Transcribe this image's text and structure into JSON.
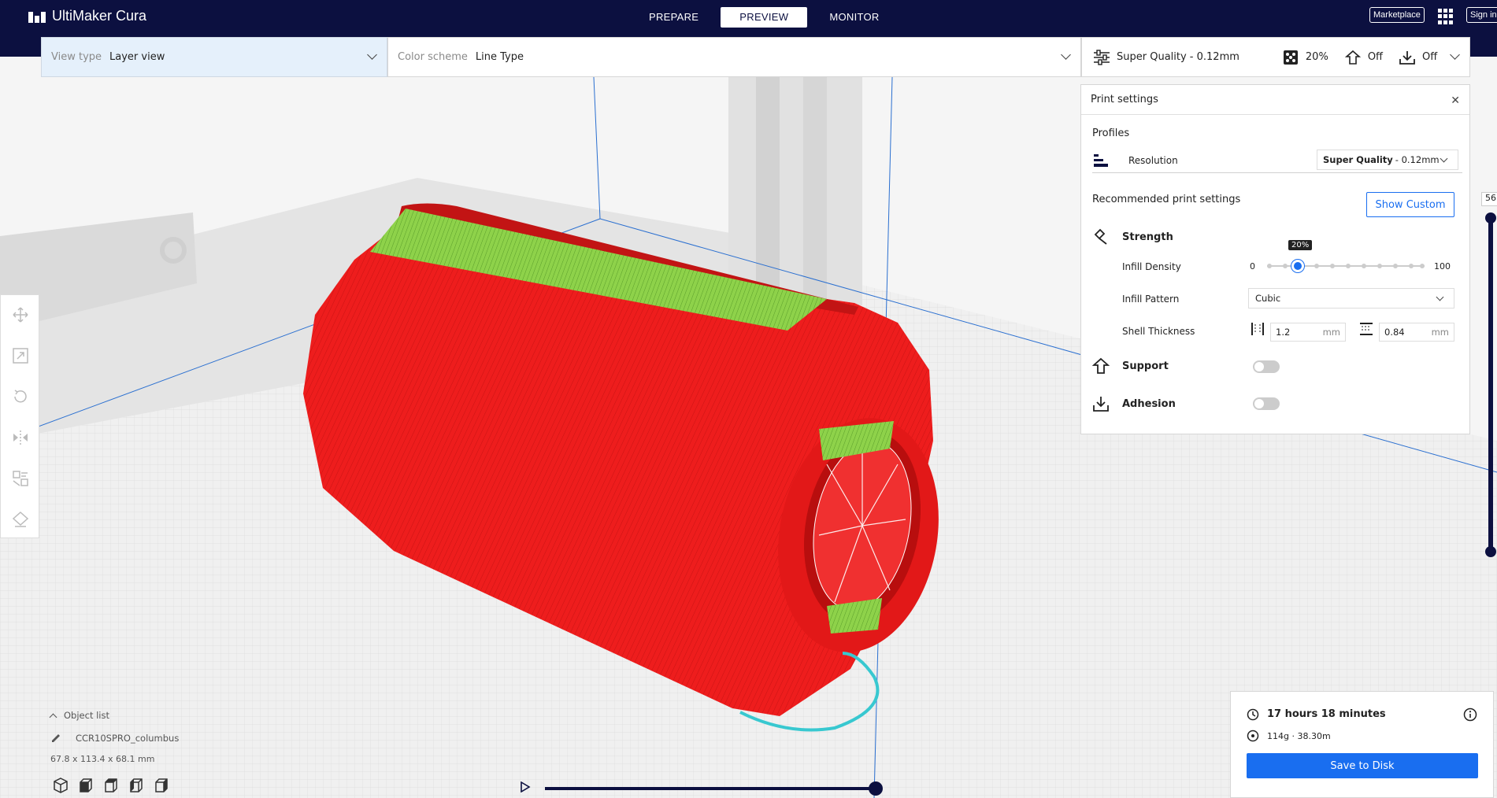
{
  "app": {
    "title": "UltiMaker Cura"
  },
  "nav": {
    "tabs": [
      "PREPARE",
      "PREVIEW",
      "MONITOR"
    ],
    "active": "PREVIEW"
  },
  "header": {
    "marketplace": "Marketplace",
    "signin": "Sign in"
  },
  "viewbar": {
    "label": "View type",
    "value": "Layer view"
  },
  "colorbar": {
    "label": "Color scheme",
    "value": "Line Type"
  },
  "printbar": {
    "profile": "Super Quality - 0.12mm",
    "infill": "20%",
    "support": "Off",
    "adhesion": "Off"
  },
  "panel": {
    "title": "Print settings",
    "profiles_label": "Profiles",
    "resolution_label": "Resolution",
    "resolution_bold": "Super Quality",
    "resolution_rest": "- 0.12mm",
    "recommended": "Recommended print settings",
    "show_custom": "Show Custom",
    "strength": "Strength",
    "infill_density": "Infill Density",
    "infill_min": "0",
    "infill_max": "100",
    "infill_value_label": "20%",
    "infill_fraction": 0.2,
    "infill_pattern": "Infill Pattern",
    "infill_pattern_value": "Cubic",
    "shell_thickness": "Shell Thickness",
    "wall_value": "1.2",
    "top_value": "0.84",
    "unit": "mm",
    "support": "Support",
    "adhesion": "Adhesion",
    "support_on": false,
    "adhesion_on": false
  },
  "layer": {
    "number": "56"
  },
  "objects": {
    "header": "Object list",
    "name": "CCR10SPRO_columbus",
    "dims": "67.8 x 113.4 x 68.1 mm"
  },
  "estimate": {
    "time": "17 hours 18 minutes",
    "material": "114g · 38.30m",
    "save": "Save to Disk"
  },
  "colors": {
    "navy": "#0c1040",
    "accent": "#196ef0",
    "model_red": "#ee1d1d",
    "infill_green": "#7ac943",
    "travel_cyan": "#38c8d0"
  }
}
